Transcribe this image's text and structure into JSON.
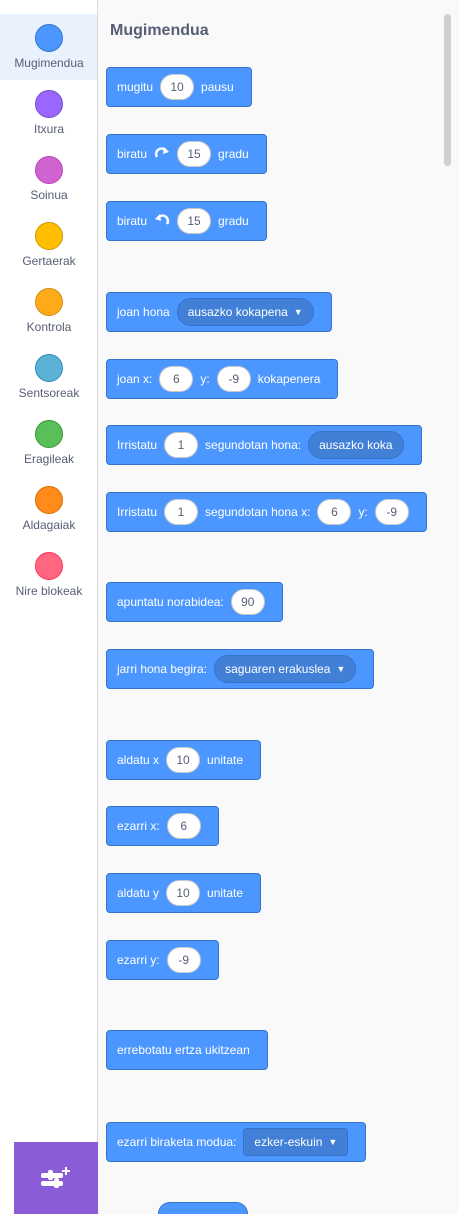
{
  "categories": [
    {
      "label": "Mugimendua",
      "color": "#4c97ff",
      "border": "#3373cc"
    },
    {
      "label": "Itxura",
      "color": "#9966ff",
      "border": "#774dcb"
    },
    {
      "label": "Soinua",
      "color": "#cf63cf",
      "border": "#bd42bd"
    },
    {
      "label": "Gertaerak",
      "color": "#ffbf00",
      "border": "#cc9900"
    },
    {
      "label": "Kontrola",
      "color": "#ffab19",
      "border": "#cf8b17"
    },
    {
      "label": "Sentsoreak",
      "color": "#5cb1d6",
      "border": "#2e8eb8"
    },
    {
      "label": "Eragileak",
      "color": "#59c059",
      "border": "#389438"
    },
    {
      "label": "Aldagaiak",
      "color": "#ff8c1a",
      "border": "#db6e00"
    },
    {
      "label": "Nire blokeak",
      "color": "#ff6680",
      "border": "#ff3355"
    }
  ],
  "palette": {
    "title": "Mugimendua",
    "move": {
      "t1": "mugitu",
      "n1": "10",
      "t2": "pausu"
    },
    "turn_right": {
      "t1": "biratu",
      "n1": "15",
      "t2": "gradu",
      "icon": "rotate-right-icon"
    },
    "turn_left": {
      "t1": "biratu",
      "n1": "15",
      "t2": "gradu",
      "icon": "rotate-left-icon"
    },
    "goto": {
      "t1": "joan hona",
      "d1": "ausazko kokapena"
    },
    "goto_xy": {
      "t1": "joan x:",
      "n1": "6",
      "t2": "y:",
      "n2": "-9",
      "t3": "kokapenera"
    },
    "glide": {
      "t1": "Irristatu",
      "n1": "1",
      "t2": "segundotan hona:",
      "d1": "ausazko koka"
    },
    "glide_xy": {
      "t1": "Irristatu",
      "n1": "1",
      "t2": "segundotan hona x:",
      "n2": "6",
      "t3": "y:",
      "n3": "-9"
    },
    "point_dir": {
      "t1": "apuntatu norabidea:",
      "n1": "90"
    },
    "point_towards": {
      "t1": "jarri hona begira:",
      "d1": "saguaren erakuslea"
    },
    "change_x": {
      "t1": "aldatu x",
      "n1": "10",
      "t2": "unitate"
    },
    "set_x": {
      "t1": "ezarri x:",
      "n1": "6"
    },
    "change_y": {
      "t1": "aldatu y",
      "n1": "10",
      "t2": "unitate"
    },
    "set_y": {
      "t1": "ezarri y:",
      "n1": "-9"
    },
    "bounce": {
      "t1": "errebotatu ertza ukitzean"
    },
    "rotation_style": {
      "t1": "ezarri biraketa modua:",
      "d1": "ezker-eskuin"
    }
  },
  "extension_button": {
    "icon": "add-extension-icon",
    "color": "#8a5cd7"
  }
}
